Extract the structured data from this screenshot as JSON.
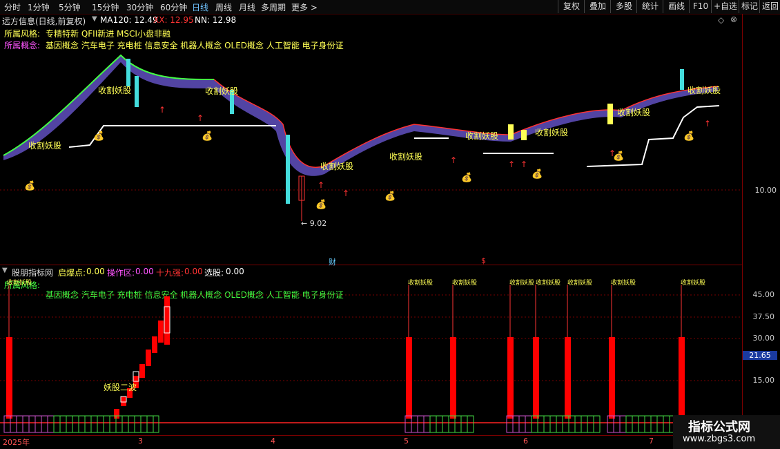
{
  "toolbar": {
    "periods": [
      "分时",
      "1分钟",
      "5分钟",
      "15分钟",
      "30分钟",
      "60分钟",
      "日线",
      "周线",
      "月线",
      "多周期",
      "更多 >"
    ],
    "active_period": "日线",
    "right_buttons": [
      "复权",
      "叠加",
      "多股",
      "统计",
      "画线",
      "F10",
      "+自选",
      "标记",
      "返回"
    ]
  },
  "main": {
    "title": "远方信息(日线,前复权)",
    "ma_label": "MA120: 12.49",
    "xx_label": "XX: 12.95",
    "nn_label": "NN: 12.98",
    "style_label": "所属风格:",
    "style_value": "专精特新 QFII新进 MSCI小盘非融",
    "concept_label": "所属概念:",
    "concept_value": "基因概念 汽车电子 充电桩 信息安全 机器人概念 OLED概念 人工智能 电子身份证",
    "signal_label": "收割妖股",
    "low_marker": "← 9.02",
    "price_axis": "10.00",
    "event_cai": "财",
    "event_s": "$"
  },
  "sub": {
    "indicator_name": "股朋指标网",
    "values": [
      {
        "label": "启爆点:",
        "value": "0.00"
      },
      {
        "label": "操作区:",
        "value": "0.00"
      },
      {
        "label": "十九强:",
        "value": "0.00"
      },
      {
        "label": "选股:",
        "value": "0.00"
      }
    ],
    "overlay_style": "所属风格:",
    "overlay_concept": "基因概念 汽车电子 充电桩 信息安全 机器人概念 OLED概念 人工智能 电子身份证",
    "mark_label": "收割妖股",
    "yaoguo_label": "妖股二波",
    "y_axis": [
      "45.00",
      "37.50",
      "30.00",
      "21.65",
      "15.00"
    ]
  },
  "x_axis": {
    "labels": [
      "2025年",
      "3",
      "4",
      "5",
      "6",
      "7"
    ]
  },
  "watermark": {
    "title": "指标公式网",
    "url": "www.zbgs3.com"
  },
  "colors": {
    "up": "#ff3333",
    "down": "#44dddd",
    "accent": "#ffff55",
    "concept": "#ff55ff"
  }
}
